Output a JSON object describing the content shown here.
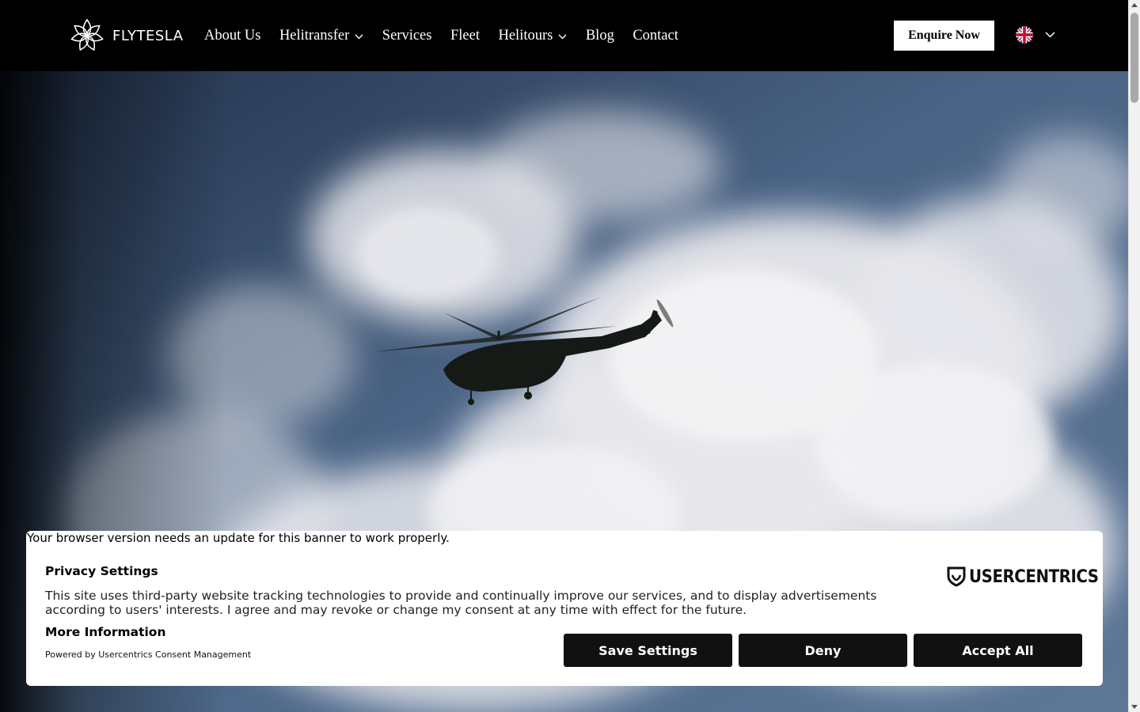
{
  "brand": {
    "name": "FLYTESLA",
    "logo_icon": "lotus-logo-icon"
  },
  "nav": [
    {
      "label": "About Us",
      "dropdown": false
    },
    {
      "label": "Helitransfer",
      "dropdown": true
    },
    {
      "label": "Services",
      "dropdown": false
    },
    {
      "label": "Fleet",
      "dropdown": false
    },
    {
      "label": "Helitours",
      "dropdown": true
    },
    {
      "label": "Blog",
      "dropdown": false
    },
    {
      "label": "Contact",
      "dropdown": false
    }
  ],
  "cta": {
    "label": "Enquire Now"
  },
  "language": {
    "icon": "uk-flag-icon",
    "selected": "English"
  },
  "hero": {
    "image": "helicopter-in-cloudy-sky"
  },
  "consent": {
    "warning": "Your browser version needs an update for this banner to work properly.",
    "title": "Privacy Settings",
    "text": "This site uses third-party website tracking technologies to provide and continually improve our services, and to display advertisements according to users' interests. I agree and may revoke or change my consent at any time with effect for the future.",
    "more_info": "More Information",
    "powered_by": "Powered by Usercentrics Consent Management",
    "logo_text": "USERCENTRICS",
    "buttons": {
      "save": "Save Settings",
      "deny": "Deny",
      "accept": "Accept All"
    }
  },
  "colors": {
    "header_bg": "#000000",
    "cta_bg": "#ffffff",
    "button_bg": "#111111",
    "banner_bg": "#ffffff"
  }
}
